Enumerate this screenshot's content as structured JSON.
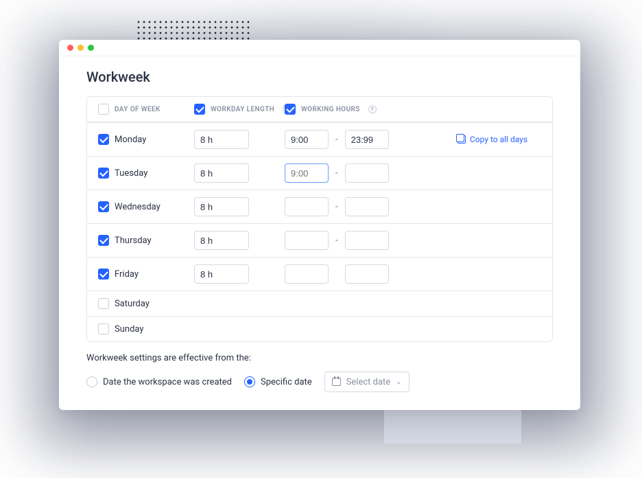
{
  "title": "Workweek",
  "headers": {
    "day": "DAY OF WEEK",
    "length": "WORKDAY LENGTH",
    "hours": "WORKING HOURS"
  },
  "days": [
    {
      "name": "Monday",
      "enabled": true,
      "length": "8 h",
      "start": "9:00",
      "end": "23:99",
      "copy": true
    },
    {
      "name": "Tuesday",
      "enabled": true,
      "length": "8 h",
      "start_placeholder": "9:00",
      "end": ""
    },
    {
      "name": "Wednesday",
      "enabled": true,
      "length": "8 h",
      "start": "",
      "end": ""
    },
    {
      "name": "Thursday",
      "enabled": true,
      "length": "8 h",
      "start": "",
      "end": ""
    },
    {
      "name": "Friday",
      "enabled": true,
      "length": "8 h",
      "start": "",
      "end": "",
      "no_dash": true
    },
    {
      "name": "Saturday",
      "enabled": false
    },
    {
      "name": "Sunday",
      "enabled": false
    }
  ],
  "copy_label": "Copy to all days",
  "footnote": "Workweek settings are effective from the:",
  "effective": {
    "created": "Date the workspace was created",
    "specific": "Specific date",
    "select_date": "Select date"
  }
}
